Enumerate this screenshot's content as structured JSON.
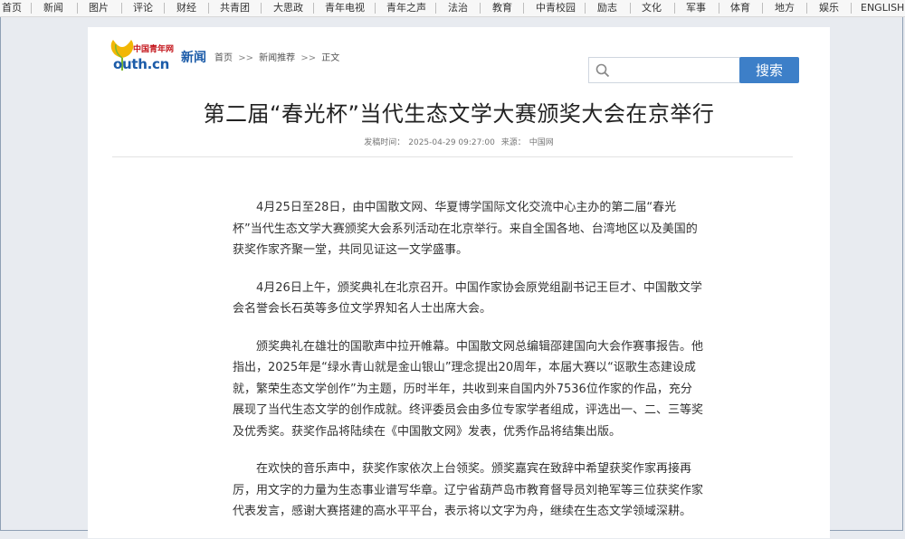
{
  "nav": {
    "items": [
      "首页",
      "新闻",
      "图片",
      "评论",
      "财经",
      "共青团",
      "大思政",
      "青年电视",
      "青年之声",
      "法治",
      "教育",
      "中青校园",
      "励志",
      "文化",
      "军事",
      "体育",
      "地方",
      "娱乐",
      "ENGLISH"
    ]
  },
  "header": {
    "logo_small": "中国青年网",
    "logo_main": "outh.cn",
    "channel": "新闻",
    "breadcrumb": [
      "首页",
      "新闻推荐",
      "正文"
    ],
    "breadcrumb_sep": ">>"
  },
  "search": {
    "value": "",
    "placeholder": "",
    "button_label": "搜索"
  },
  "article": {
    "title": "第二届“春光杯”当代生态文学大赛颁奖大会在京举行",
    "meta_label_time": "发稿时间：",
    "meta_time": "2025-04-29 09:27:00",
    "meta_label_source": "来源：",
    "meta_source": "中国网",
    "paragraphs": [
      "4月25日至28日，由中国散文网、华夏博学国际文化交流中心主办的第二届“春光杯”当代生态文学大赛颁奖大会系列活动在北京举行。来自全国各地、台湾地区以及美国的获奖作家齐聚一堂，共同见证这一文学盛事。",
      "4月26日上午，颁奖典礼在北京召开。中国作家协会原党组副书记王巨才、中国散文学会名誉会长石英等多位文学界知名人士出席大会。",
      "颁奖典礼在雄壮的国歌声中拉开帷幕。中国散文网总编辑邵建国向大会作赛事报告。他指出，2025年是“绿水青山就是金山银山”理念提出20周年，本届大赛以“讴歌生态建设成就，繁荣生态文学创作”为主题，历时半年，共收到来自国内外7536位作家的作品，充分展现了当代生态文学的创作成就。终评委员会由多位专家学者组成，评选出一、二、三等奖及优秀奖。获奖作品将陆续在《中国散文网》发表，优秀作品将结集出版。",
      "在欢快的音乐声中，获奖作家依次上台领奖。颁奖嘉宾在致辞中希望获奖作家再接再厉，用文字的力量为生态事业谱写华章。辽宁省葫芦岛市教育督导员刘艳军等三位获奖作家代表发言，感谢大赛搭建的高水平平台，表示将以文字为舟，继续在生态文学领域深耕。"
    ]
  },
  "colors": {
    "accent": "#3d7fc8",
    "brand_blue": "#1b5ba8",
    "brand_red": "#c4161c",
    "leaf_yellow": "#f2b705",
    "leaf_green": "#7cb82f"
  }
}
